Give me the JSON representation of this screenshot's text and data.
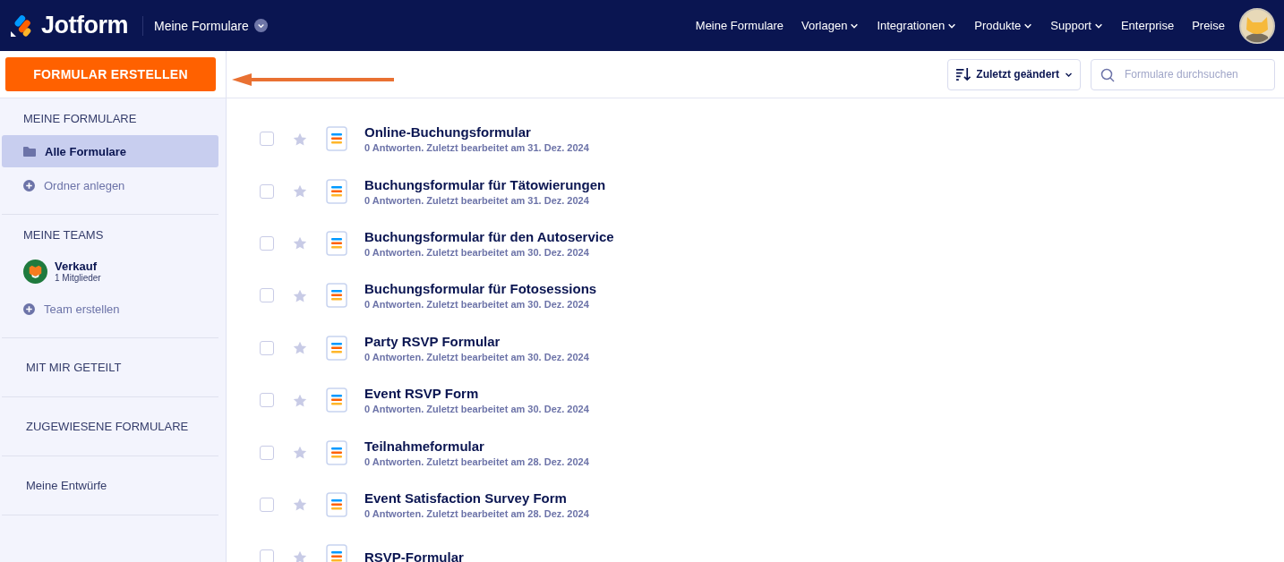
{
  "header": {
    "logo": "Jotform",
    "workspace": "Meine Formulare",
    "nav": [
      {
        "label": "Meine Formulare",
        "dropdown": false
      },
      {
        "label": "Vorlagen",
        "dropdown": true
      },
      {
        "label": "Integrationen",
        "dropdown": true
      },
      {
        "label": "Produkte",
        "dropdown": true
      },
      {
        "label": "Support",
        "dropdown": true
      },
      {
        "label": "Enterprise",
        "dropdown": false
      },
      {
        "label": "Preise",
        "dropdown": false
      }
    ]
  },
  "create_button": "FORMULAR ERSTELLEN",
  "toolbar": {
    "sort": "Zuletzt geändert",
    "search": {
      "placeholder": "Formulare durchsuchen"
    }
  },
  "sidebar": {
    "sections": [
      {
        "kind": "group",
        "heading": "MEINE FORMULARE",
        "items": [
          {
            "kind": "folder",
            "label": "Alle Formulare",
            "selected": true
          },
          {
            "kind": "add",
            "label": "Ordner anlegen",
            "selected": false
          }
        ]
      },
      {
        "kind": "group",
        "heading": "MEINE TEAMS",
        "items": [
          {
            "kind": "team",
            "label": "Verkauf",
            "sublabel": "1 Mitglieder",
            "selected": false
          },
          {
            "kind": "add",
            "label": "Team erstellen",
            "selected": false
          }
        ]
      },
      {
        "kind": "link",
        "heading": "MIT MIR GETEILT"
      },
      {
        "kind": "link",
        "heading": "ZUGEWIESENE FORMULARE"
      },
      {
        "kind": "link",
        "heading": "Meine Entwürfe"
      }
    ]
  },
  "forms": [
    {
      "title": "Online-Buchungsformular",
      "info": "0 Antworten. Zuletzt bearbeitet am 31. Dez. 2024",
      "checked": false,
      "starred": false
    },
    {
      "title": "Buchungsformular für Tätowierungen",
      "info": "0 Antworten. Zuletzt bearbeitet am 31. Dez. 2024",
      "checked": false,
      "starred": false
    },
    {
      "title": "Buchungsformular für den Autoservice",
      "info": "0 Antworten. Zuletzt bearbeitet am 30. Dez. 2024",
      "checked": false,
      "starred": false
    },
    {
      "title": "Buchungsformular für Fotosessions",
      "info": "0 Antworten. Zuletzt bearbeitet am 30. Dez. 2024",
      "checked": false,
      "starred": false
    },
    {
      "title": "Party RSVP Formular",
      "info": "0 Antworten. Zuletzt bearbeitet am 30. Dez. 2024",
      "checked": false,
      "starred": false
    },
    {
      "title": "Event RSVP Form",
      "info": "0 Antworten. Zuletzt bearbeitet am 30. Dez. 2024",
      "checked": false,
      "starred": false
    },
    {
      "title": "Teilnahmeformular",
      "info": "0 Antworten. Zuletzt bearbeitet am 28. Dez. 2024",
      "checked": false,
      "starred": false
    },
    {
      "title": "Event Satisfaction Survey Form",
      "info": "0 Antworten. Zuletzt bearbeitet am 28. Dez. 2024",
      "checked": false,
      "starred": false
    },
    {
      "title": "RSVP-Formular",
      "checked": false,
      "starred": false
    }
  ]
}
